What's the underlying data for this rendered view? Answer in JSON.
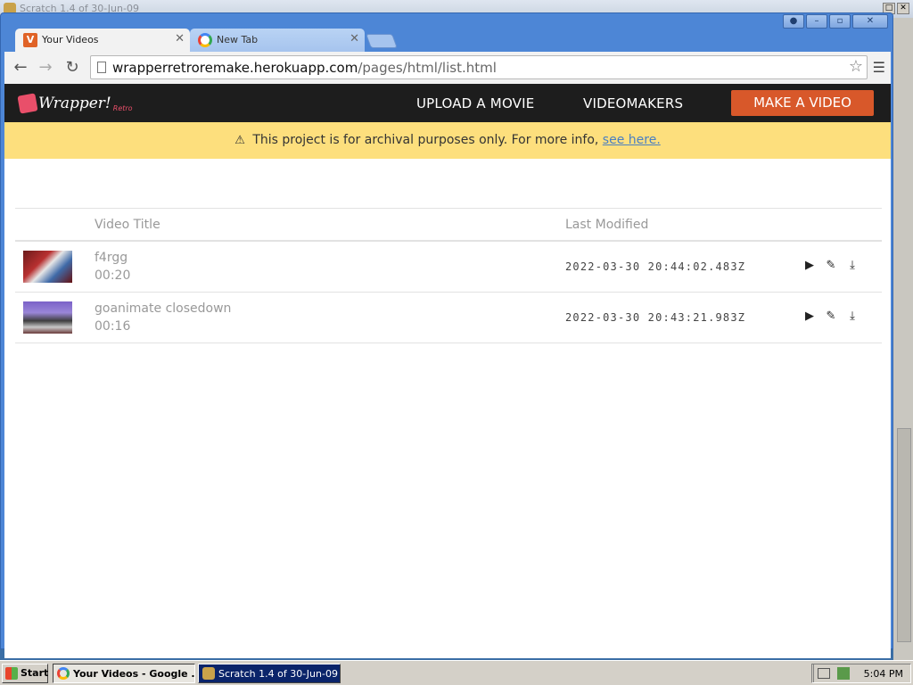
{
  "background_window": {
    "title": "Scratch 1.4 of 30-Jun-09"
  },
  "browser": {
    "tabs": [
      {
        "label": "Your Videos",
        "active": true
      },
      {
        "label": "New Tab",
        "active": false
      }
    ],
    "url_host": "wrapperretroremake.herokuapp.com",
    "url_path": "/pages/html/list.html"
  },
  "site": {
    "logo_text": "Wrapper!",
    "logo_sub": "Retro",
    "nav": {
      "upload": "UPLOAD A MOVIE",
      "videomakers": "VIDEOMAKERS",
      "make": "MAKE A VIDEO"
    },
    "banner": {
      "text": "This project is for archival purposes only. For more info,",
      "link": "see here."
    },
    "table": {
      "col_title": "Video Title",
      "col_modified": "Last Modified",
      "rows": [
        {
          "title": "f4rgg",
          "duration": "00:20",
          "modified": "2022-03-30  20:44:02.483Z"
        },
        {
          "title": "goanimate closedown",
          "duration": "00:16",
          "modified": "2022-03-30  20:43:21.983Z"
        }
      ]
    },
    "colors": {
      "nav_bg": "#1d1d1d",
      "cta": "#d8582a",
      "banner_bg": "#fddf7d",
      "link": "#4a7fc1"
    }
  },
  "taskbar": {
    "start": "Start",
    "items": [
      {
        "label": "Your Videos - Google ...",
        "active": true
      },
      {
        "label": "Scratch 1.4 of 30-Jun-09",
        "active": false
      }
    ],
    "clock": "5:04 PM"
  }
}
